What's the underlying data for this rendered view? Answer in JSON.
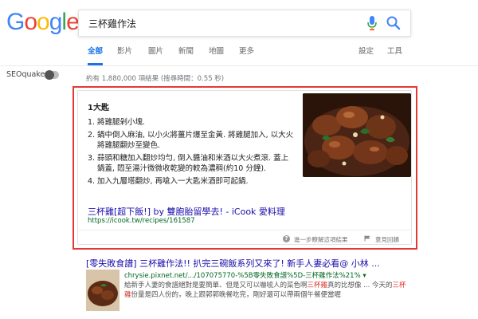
{
  "logo": {
    "letters": [
      "G",
      "o",
      "o",
      "g",
      "l",
      "e"
    ],
    "colors": [
      "#4285F4",
      "#EA4335",
      "#FBBC05",
      "#4285F4",
      "#34A853",
      "#EA4335"
    ]
  },
  "search": {
    "value": "三杯雞作法",
    "mic_icon": "mic-icon",
    "search_icon": "search-icon"
  },
  "tabs": [
    {
      "label": "全部",
      "active": true
    },
    {
      "label": "影片"
    },
    {
      "label": "圖片"
    },
    {
      "label": "新聞"
    },
    {
      "label": "地圖"
    },
    {
      "label": "更多"
    },
    {
      "label": "設定"
    },
    {
      "label": "工具"
    }
  ],
  "seoquake": {
    "label": "SEOquake",
    "toggle_on": false
  },
  "result_stats": "約有 1,880,000 項結果 (搜尋時間：0.55 秒)",
  "featured_snippet": {
    "heading": "1大匙",
    "steps": [
      {
        "num": "1.",
        "text": "將雞腿剁小塊."
      },
      {
        "num": "2.",
        "text": "鍋中倒入麻油, 以小火將薑片爆至金黃. 將雞腿加入, 以大火將雞腿翻炒至變色."
      },
      {
        "num": "3.",
        "text": "蒜頭和糖加入翻炒均勻, 倒入醬油和米酒以大火煮滾. 蓋上鍋蓋, 悶至湯汁微微收乾變的較為濃稠(約10 分鐘)."
      },
      {
        "num": "4.",
        "text": "加入九層塔翻炒, 再嗆入一大匙米酒即可起鍋."
      }
    ],
    "source_title": "三杯雞[超下飯!] by 雙胞胎留學去! - iCook 愛料理",
    "source_url": "https://icook.tw/recipes/161587",
    "learn_more": "進一步瞭解這項結果",
    "feedback": "意見回饋"
  },
  "result2": {
    "title": "[零失敗食譜] 三杯雞作法!! 扒完三碗飯系列又來了! 新手人妻必看@ 小林 ...",
    "url": "chrysie.pixnet.net/.../107075770-%5B零失敗食譜%5D-三杯雞作法%21% ▾",
    "desc_parts": [
      {
        "text": "給新手人妻的食譜絕對是要簡單、但是又可以嚇唬人的菜色啊",
        "hl": false
      },
      {
        "text": "三杯雞",
        "hl": true
      },
      {
        "text": "真的比想像 ... 今天的",
        "hl": false
      },
      {
        "text": "三杯雞",
        "hl": true
      },
      {
        "text": "份量是四人份的，晚上跟郭郭晚餐吃完，剛好還可以帶兩個午餐便當喔",
        "hl": false
      }
    ]
  }
}
